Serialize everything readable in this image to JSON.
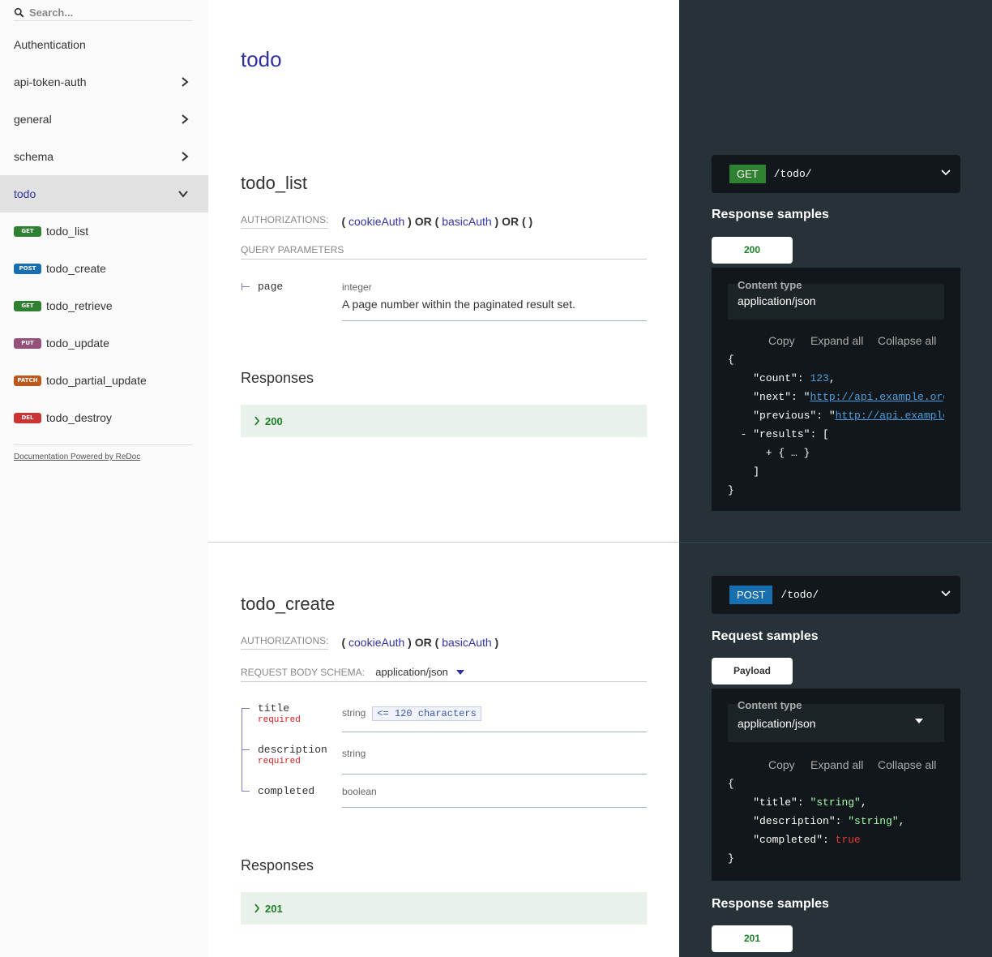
{
  "sidebar": {
    "search_placeholder": "Search...",
    "items": [
      {
        "label": "Authentication"
      },
      {
        "label": "api-token-auth"
      },
      {
        "label": "general"
      },
      {
        "label": "schema"
      },
      {
        "label": "todo"
      }
    ],
    "operations": [
      {
        "method": "GET",
        "label": "todo_list",
        "color": "#2F8132"
      },
      {
        "method": "POST",
        "label": "todo_create",
        "color": "#186FAF"
      },
      {
        "method": "GET",
        "label": "todo_retrieve",
        "color": "#2F8132"
      },
      {
        "method": "PUT",
        "label": "todo_update",
        "color": "#95507C"
      },
      {
        "method": "PATCH",
        "label": "todo_partial_update",
        "color": "#BF581D"
      },
      {
        "method": "DEL",
        "label": "todo_destroy",
        "color": "#CC3333"
      }
    ],
    "powered_by": "Documentation Powered by ReDoc"
  },
  "main": {
    "tag_title": "todo",
    "list": {
      "title": "todo_list",
      "auth_label": "AUTHORIZATIONS:",
      "auth_cookie": "cookieAuth",
      "auth_basic": "basicAuth",
      "query_label": "QUERY PARAMETERS",
      "param_name": "page",
      "param_type": "integer",
      "param_desc": "A page number within the paginated result set.",
      "responses_title": "Responses",
      "response_code": "200"
    },
    "create": {
      "title": "todo_create",
      "auth_label": "AUTHORIZATIONS:",
      "auth_cookie": "cookieAuth",
      "auth_basic": "basicAuth",
      "body_label": "REQUEST BODY SCHEMA:",
      "body_type": "application/json",
      "fields": [
        {
          "name": "title",
          "required": "required",
          "type": "string",
          "constraint": "<= 120 characters"
        },
        {
          "name": "description",
          "required": "required",
          "type": "string"
        },
        {
          "name": "completed",
          "type": "boolean"
        }
      ],
      "responses_title": "Responses",
      "response_code": "201"
    }
  },
  "right": {
    "list": {
      "method": "GET",
      "method_color": "#2F8132",
      "path": "/todo/",
      "samples_title": "Response samples",
      "tab": "200",
      "ct_label": "Content type",
      "ct_value": "application/json",
      "copy": "Copy",
      "expand": "Expand all",
      "collapse": "Collapse all",
      "code": {
        "count_val": "123",
        "next_url": "http://api.example.org",
        "prev_url": "http://api.example.org"
      }
    },
    "create": {
      "method": "POST",
      "method_color": "#186FAF",
      "path": "/todo/",
      "request_title": "Request samples",
      "tab": "Payload",
      "ct_label": "Content type",
      "ct_value": "application/json",
      "copy": "Copy",
      "expand": "Expand all",
      "collapse": "Collapse all",
      "code": {
        "title_val": "\"string\"",
        "desc_val": "\"string\"",
        "completed_val": "true"
      },
      "response_title": "Response samples",
      "response_tab": "201"
    }
  }
}
